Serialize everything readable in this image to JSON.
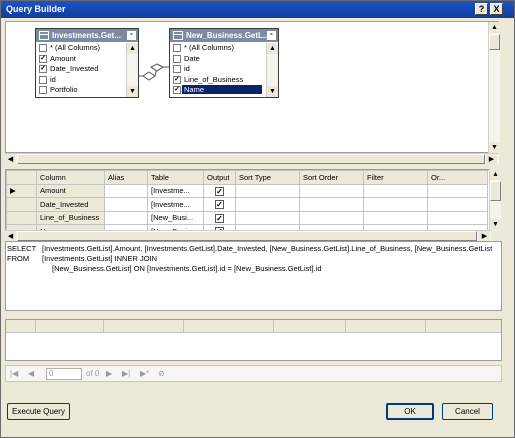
{
  "window": {
    "title": "Query Builder",
    "help_button": "?",
    "close_button": "X"
  },
  "diagram": {
    "tables": [
      {
        "name": "Investments.Get...",
        "columns": [
          {
            "label": "* (All Columns)",
            "checked": false
          },
          {
            "label": "Amount",
            "checked": true
          },
          {
            "label": "Date_Invested",
            "checked": true
          },
          {
            "label": "id",
            "checked": false
          },
          {
            "label": "Portfolio",
            "checked": false
          }
        ]
      },
      {
        "name": "New_Business.GetL...",
        "columns": [
          {
            "label": "* (All Columns)",
            "checked": false
          },
          {
            "label": "Date",
            "checked": false
          },
          {
            "label": "id",
            "checked": false
          },
          {
            "label": "Line_of_Business",
            "checked": true
          },
          {
            "label": "Name",
            "checked": true,
            "selected": true
          }
        ]
      }
    ]
  },
  "criteria_grid": {
    "headers": [
      "Column",
      "Alias",
      "Table",
      "Output",
      "Sort Type",
      "Sort Order",
      "Filter",
      "Or..."
    ],
    "rows": [
      {
        "column": "Amount",
        "alias": "",
        "table": "[Investme...",
        "output": true,
        "current": true
      },
      {
        "column": "Date_Invested",
        "alias": "",
        "table": "[Investme...",
        "output": true,
        "current": false
      },
      {
        "column": "Line_of_Business",
        "alias": "",
        "table": "[New_Busi...",
        "output": true,
        "current": false
      },
      {
        "column": "N...",
        "alias": "",
        "table": "[New_Busi...",
        "output": true,
        "current": false
      }
    ]
  },
  "sql": {
    "select_kw": "SELECT",
    "select_text": "[Investments.GetList].Amount, [Investments.GetList].Date_Invested, [New_Business.GetList].Line_of_Business, [New_Business.GetList",
    "from_kw": "FROM",
    "from_line1": "[Investments.GetList] INNER JOIN",
    "from_line2": "[New_Business.GetList] ON [Investments.GetList].id = [New_Business.GetList].id"
  },
  "navigator": {
    "page_value": "0",
    "of_text": "of 0"
  },
  "buttons": {
    "execute": "Execute Query",
    "ok": "OK",
    "cancel": "Cancel"
  }
}
